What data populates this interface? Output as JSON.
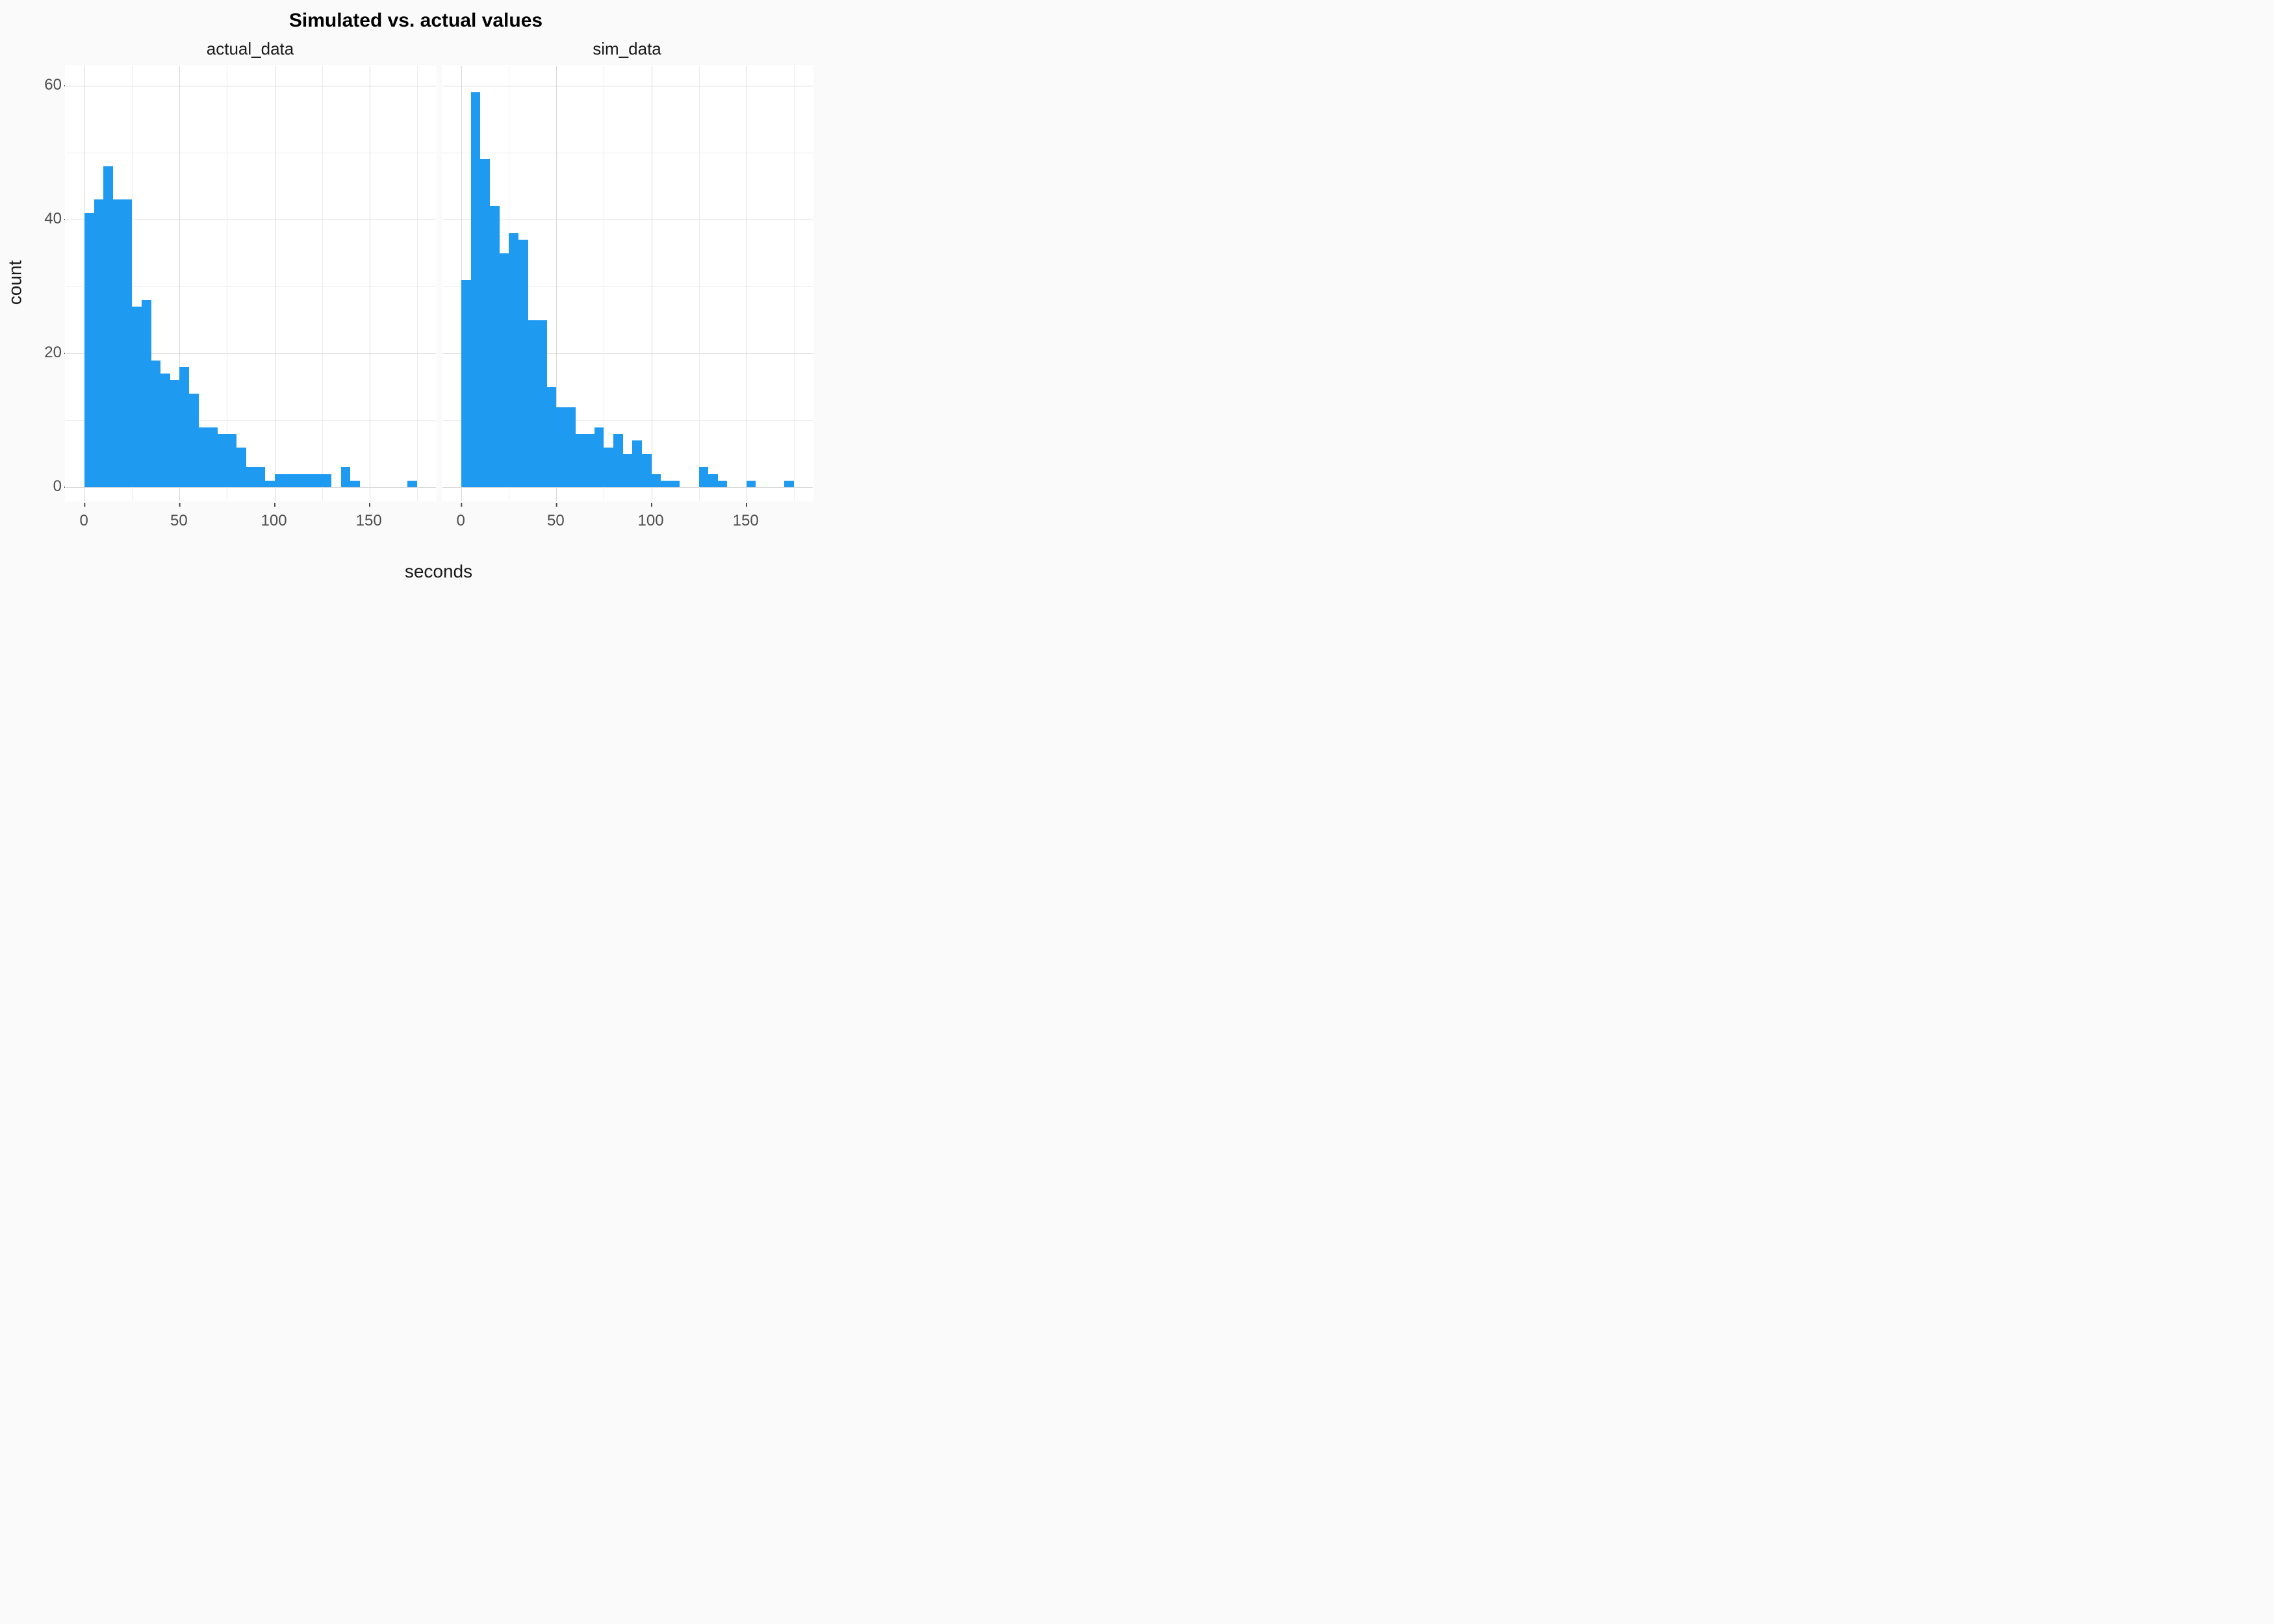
{
  "chart_data": [
    {
      "type": "bar",
      "facet": "actual_data",
      "x": [
        2.5,
        7.5,
        12.5,
        17.5,
        22.5,
        27.5,
        32.5,
        37.5,
        42.5,
        47.5,
        52.5,
        57.5,
        62.5,
        67.5,
        72.5,
        77.5,
        82.5,
        87.5,
        92.5,
        97.5,
        102.5,
        107.5,
        112.5,
        117.5,
        122.5,
        127.5,
        132.5,
        137.5,
        142.5,
        147.5,
        152.5,
        157.5,
        162.5,
        167.5,
        172.5,
        177.5
      ],
      "values": [
        41,
        43,
        48,
        43,
        43,
        27,
        28,
        19,
        17,
        16,
        18,
        14,
        9,
        9,
        8,
        8,
        6,
        3,
        3,
        1,
        2,
        2,
        2,
        2,
        2,
        2,
        0,
        3,
        1,
        0,
        0,
        0,
        0,
        0,
        1,
        0
      ],
      "title": "Simulated vs. actual values",
      "xlabel": "seconds",
      "ylabel": "count",
      "xlim": [
        -10,
        185
      ],
      "ylim": [
        -2,
        63
      ],
      "binwidth": 5
    },
    {
      "type": "bar",
      "facet": "sim_data",
      "x": [
        2.5,
        7.5,
        12.5,
        17.5,
        22.5,
        27.5,
        32.5,
        37.5,
        42.5,
        47.5,
        52.5,
        57.5,
        62.5,
        67.5,
        72.5,
        77.5,
        82.5,
        87.5,
        92.5,
        97.5,
        102.5,
        107.5,
        112.5,
        117.5,
        122.5,
        127.5,
        132.5,
        137.5,
        142.5,
        147.5,
        152.5,
        157.5,
        162.5,
        167.5,
        172.5,
        177.5
      ],
      "values": [
        31,
        59,
        49,
        42,
        35,
        38,
        37,
        25,
        25,
        15,
        12,
        12,
        8,
        8,
        9,
        6,
        8,
        5,
        7,
        5,
        2,
        1,
        1,
        0,
        0,
        3,
        2,
        1,
        0,
        0,
        1,
        0,
        0,
        0,
        1,
        0
      ],
      "title": "Simulated vs. actual values",
      "xlabel": "seconds",
      "ylabel": "count",
      "xlim": [
        -10,
        185
      ],
      "ylim": [
        -2,
        63
      ],
      "binwidth": 5
    }
  ],
  "title": "Simulated vs. actual values",
  "facets": [
    "actual_data",
    "sim_data"
  ],
  "axes": {
    "ylabel": "count",
    "xlabel": "seconds",
    "y_ticks": [
      0,
      20,
      40,
      60
    ],
    "x_ticks": [
      0,
      50,
      100,
      150
    ]
  },
  "colors": {
    "bar": "#1e9bf0",
    "background": "#fafafa",
    "panel": "#ffffff",
    "grid": "#d9d9d9"
  }
}
